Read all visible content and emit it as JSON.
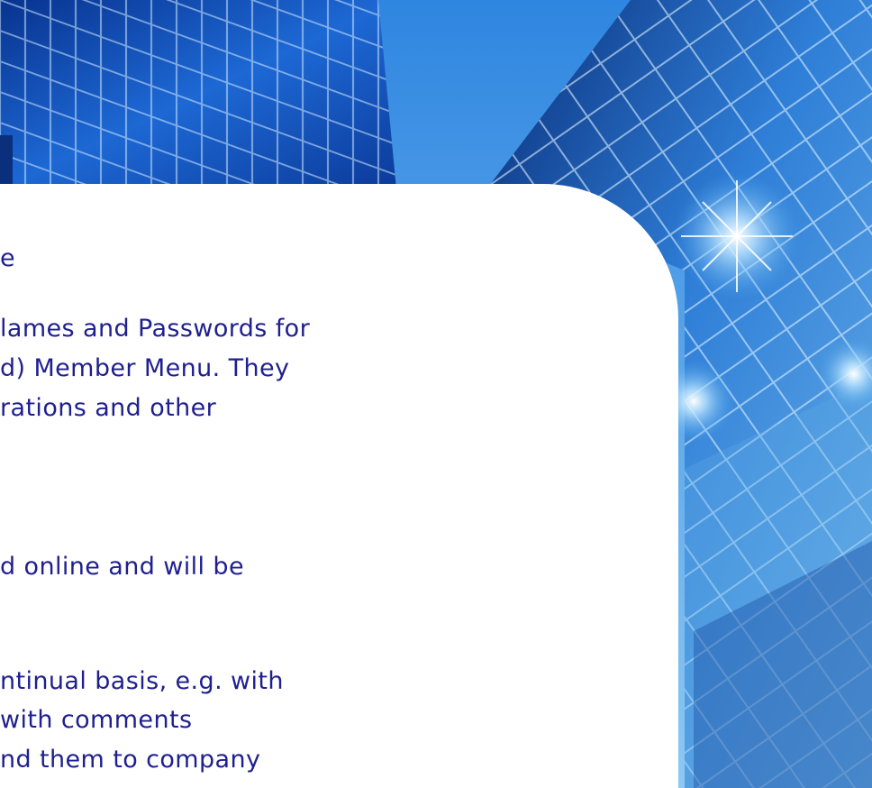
{
  "slide": {
    "lines": [
      "e",
      "lames and Passwords for",
      "d) Member Menu. They",
      "rations and other",
      "d online and will be",
      "ntinual basis, e.g. with",
      " with comments",
      "nd them to company"
    ]
  },
  "colors": {
    "text": "#1f1f8f",
    "card": "#ffffff",
    "sky": "#4aa3ea",
    "glass": "#0b4fb3"
  }
}
